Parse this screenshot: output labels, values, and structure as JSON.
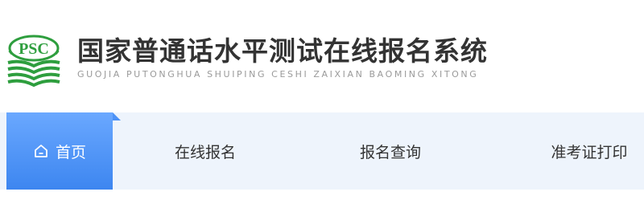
{
  "header": {
    "logo": {
      "text": "PSC",
      "icon": "psc-logo",
      "colors": {
        "green": "#2e9e3e",
        "dark": "#333333"
      }
    },
    "title_cn": "国家普通话水平测试在线报名系统",
    "title_en": "GUOJIA PUTONGHUA SHUIPING CESHI ZAIXIAN BAOMING XITONG"
  },
  "nav": {
    "items": [
      {
        "label": "首页",
        "icon": "home-icon",
        "active": true
      },
      {
        "label": "在线报名",
        "active": false
      },
      {
        "label": "报名查询",
        "active": false
      },
      {
        "label": "准考证打印",
        "active": false
      }
    ],
    "colors": {
      "active_bg": "#4d92f6",
      "bar_bg": "#eef4fc",
      "text": "#333333",
      "active_text": "#ffffff"
    }
  }
}
